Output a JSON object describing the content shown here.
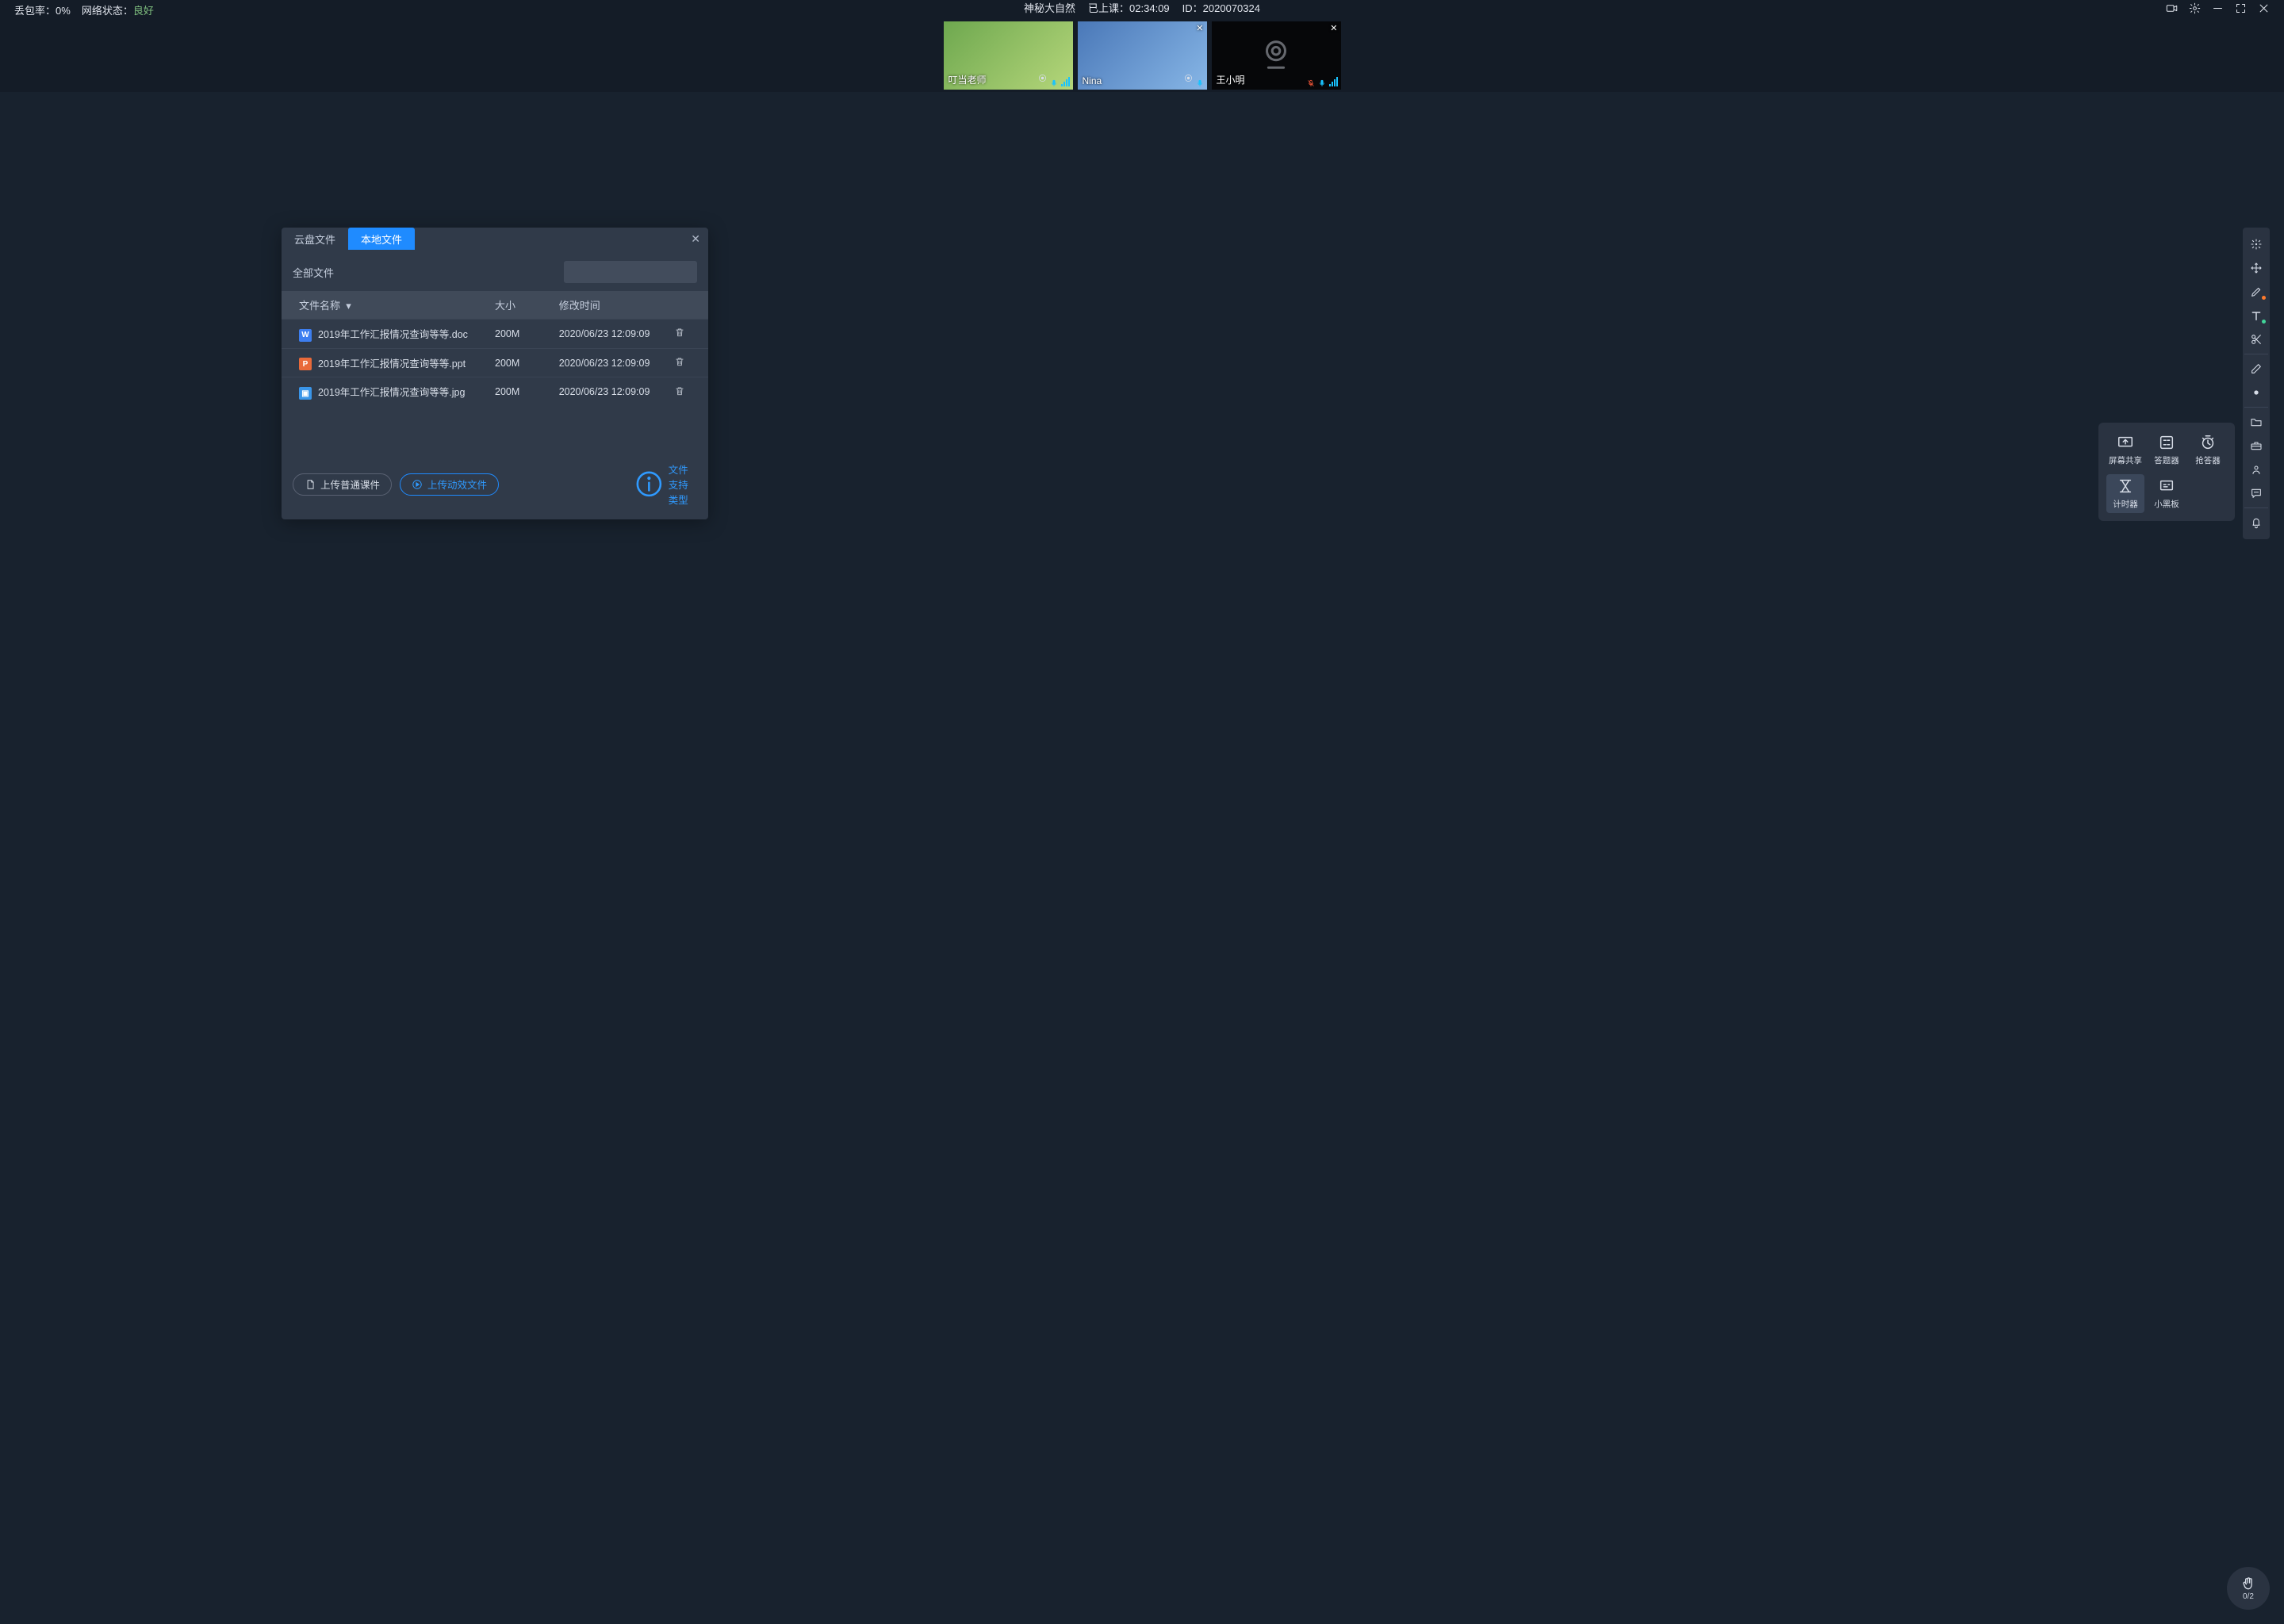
{
  "topbar": {
    "loss_label": "丢包率：",
    "loss_value": "0%",
    "net_label": "网络状态：",
    "net_value": "良好",
    "title": "神秘大自然",
    "elapsed_label": "已上课：",
    "elapsed_value": "02:34:09",
    "id_label": "ID：",
    "id_value": "2020070324"
  },
  "participants": [
    {
      "name": "叮当老师",
      "camera_off": false,
      "closable": false,
      "mic_muted": false
    },
    {
      "name": "Nina",
      "camera_off": false,
      "closable": true,
      "mic_muted": false
    },
    {
      "name": "王小明",
      "camera_off": true,
      "closable": true,
      "mic_muted": true
    }
  ],
  "dialog": {
    "tabs": {
      "cloud": "云盘文件",
      "local": "本地文件"
    },
    "active_tab": "local",
    "breadcrumb": "全部文件",
    "columns": {
      "name": "文件名称",
      "size": "大小",
      "mtime": "修改时间"
    },
    "files": [
      {
        "icon": "doc",
        "icon_letter": "W",
        "name": "2019年工作汇报情况查询等等.doc",
        "size": "200M",
        "mtime": "2020/06/23 12:09:09"
      },
      {
        "icon": "ppt",
        "icon_letter": "P",
        "name": "2019年工作汇报情况查询等等.ppt",
        "size": "200M",
        "mtime": "2020/06/23 12:09:09"
      },
      {
        "icon": "jpg",
        "icon_letter": "▣",
        "name": "2019年工作汇报情况查询等等.jpg",
        "size": "200M",
        "mtime": "2020/06/23 12:09:09"
      }
    ],
    "upload_normal": "上传普通课件",
    "upload_animated": "上传动效文件",
    "supported_label": "文件支持类型",
    "search_placeholder": ""
  },
  "popover": {
    "screen_share": "屏幕共享",
    "answer": "答题器",
    "buzzer": "抢答器",
    "timer": "计时器",
    "whiteboard": "小黑板"
  },
  "raise_hand": {
    "count": "0/2"
  }
}
